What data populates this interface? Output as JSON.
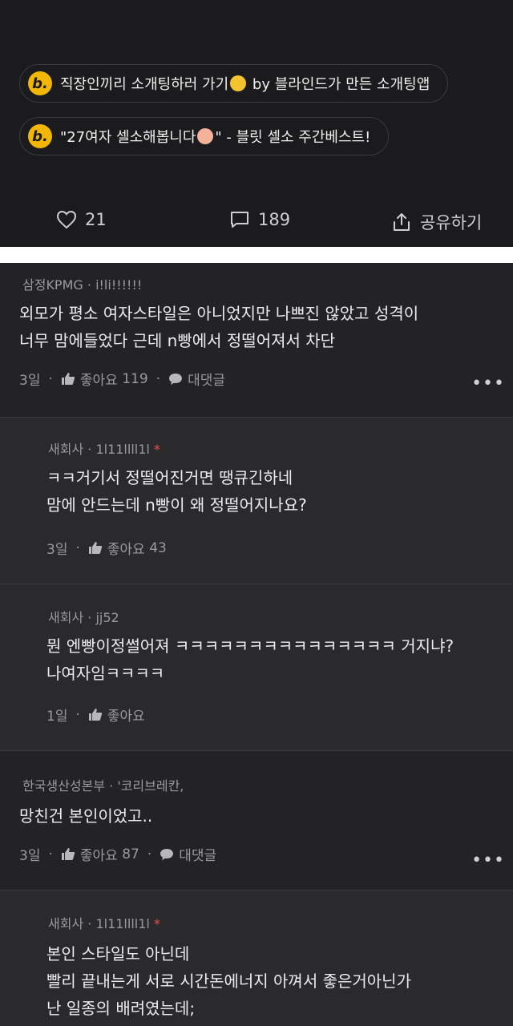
{
  "promos": [
    {
      "badge": "b.",
      "text_before": "직장인끼리 소개팅하러 가기",
      "text_after": " by 블라인드가 만든 소개팅앱",
      "emoji": "yellow-heart"
    },
    {
      "badge": "b.",
      "text_before": "\"27여자 셀소해봅니다",
      "text_after": "\" - 블릿 셀소 주간베스트!",
      "emoji": "person-raising-hand"
    }
  ],
  "post_actions": {
    "likes": "21",
    "comments": "189",
    "share": "공유하기"
  },
  "comments": [
    {
      "company": "삼정KPMG",
      "nickname": "i!li!!!!!!",
      "badge_star": false,
      "lines": [
        "외모가 평소 여자스타일은 아니었지만 나쁘진 않았고 성격이",
        "너무 맘에들었다 근데 n빵에서 정떨어져서 차단"
      ],
      "time": "3일",
      "like_label": "좋아요",
      "like_count": "119",
      "reply_label": "대댓글"
    },
    {
      "company": "새회사",
      "nickname": "1l11llll1l",
      "badge_star": true,
      "lines": [
        "ㅋㅋ거기서 정떨어진거면 땡큐긴하네",
        "맘에 안드는데 n빵이 왜 정떨어지나요?"
      ],
      "time": "3일",
      "like_label": "좋아요",
      "like_count": "43"
    },
    {
      "company": "새회사",
      "nickname": "jj52",
      "badge_star": false,
      "lines": [
        "뭔 엔빵이정썰어져 ㅋㅋㅋㅋㅋㅋㅋㅋㅋㅋㅋㅋㅋㅋㅋ 거지냐?",
        "나여자임ㅋㅋㅋㅋ"
      ],
      "time": "1일",
      "like_label": "좋아요",
      "like_count": ""
    },
    {
      "company": "한국생산성본부",
      "nickname": "'코리브레칸,",
      "badge_star": false,
      "lines": [
        "망친건 본인이었고.."
      ],
      "time": "3일",
      "like_label": "좋아요",
      "like_count": "87",
      "reply_label": "대댓글"
    },
    {
      "company": "새회사",
      "nickname": "1l11llll1l",
      "badge_star": true,
      "lines": [
        "본인 스타일도 아닌데",
        "빨리 끝내는게 서로 시간돈에너지 아껴서 좋은거아닌가",
        "난 일종의 배려였는데;"
      ]
    }
  ],
  "colors": {
    "bg": "#1b1b1d",
    "top_comment_bg": "#232325",
    "reply_bg": "#2a2a2d",
    "star": "#e3524b",
    "badge": "#f2b705"
  }
}
